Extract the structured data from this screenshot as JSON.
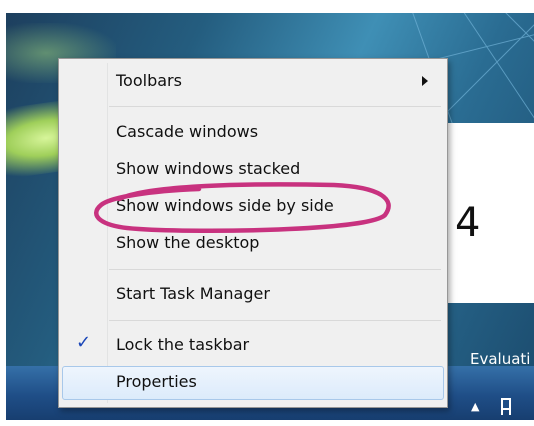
{
  "menu": {
    "items": [
      {
        "label": "Toolbars",
        "has_submenu": true
      },
      {
        "label": "Cascade windows"
      },
      {
        "label": "Show windows stacked"
      },
      {
        "label": "Show windows side by side",
        "annotated": true
      },
      {
        "label": "Show the desktop"
      },
      {
        "label": "Start Task Manager"
      },
      {
        "label": "Lock the taskbar",
        "checked": true
      },
      {
        "label": "Properties",
        "hovered": true
      }
    ]
  },
  "annotation": {
    "step_number": "4",
    "circle_color": "#c8327f"
  },
  "desktop": {
    "watermark_text": "Evaluati"
  },
  "icons": {
    "check": "checkmark-icon",
    "submenu": "chevron-right-icon",
    "tray": "action-center-flag-icon",
    "tray_arrow": "show-hidden-icons-arrow-icon"
  },
  "colors": {
    "menu_bg": "#f0f0f0",
    "selection_border": "#a8c8ea",
    "taskbar": "#1f4e87",
    "check": "#1a46b8"
  }
}
